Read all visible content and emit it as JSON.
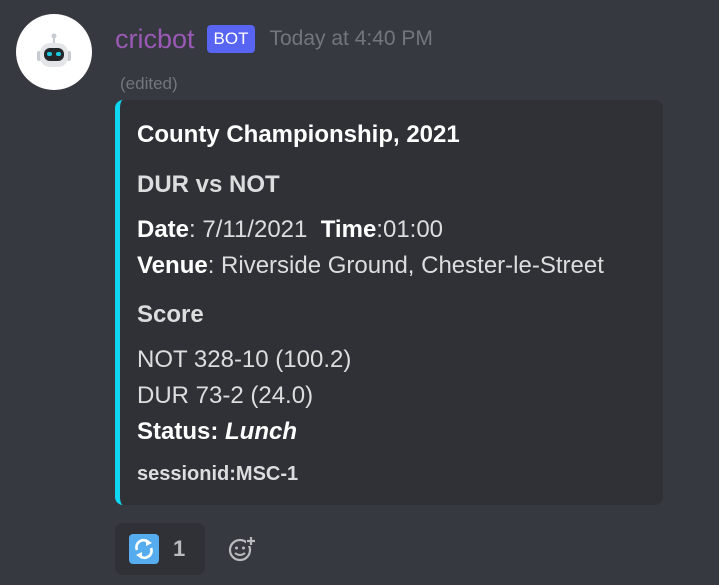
{
  "message": {
    "author": "cricbot",
    "bot_tag": "BOT",
    "timestamp": "Today at 4:40 PM",
    "edited": "(edited)",
    "avatar_icon": "robot-icon"
  },
  "embed": {
    "accent_color": "#0fd7f2",
    "title": "County Championship, 2021",
    "match": "DUR vs NOT",
    "date_label": "Date",
    "date_value": ": 7/11/2021",
    "time_label": "Time",
    "time_value": ":01:00",
    "venue_label": "Venue",
    "venue_value": ": Riverside Ground, Chester-le-Street",
    "score_label": "Score",
    "scores": [
      "NOT 328-10 (100.2)",
      "DUR 73-2 (24.0)"
    ],
    "status_label": "Status:",
    "status_value": "Lunch",
    "session": "sessionid:MSC-1"
  },
  "reactions": [
    {
      "icon": "refresh-icon",
      "count": "1"
    }
  ],
  "add_reaction_icon": "add-reaction-icon"
}
